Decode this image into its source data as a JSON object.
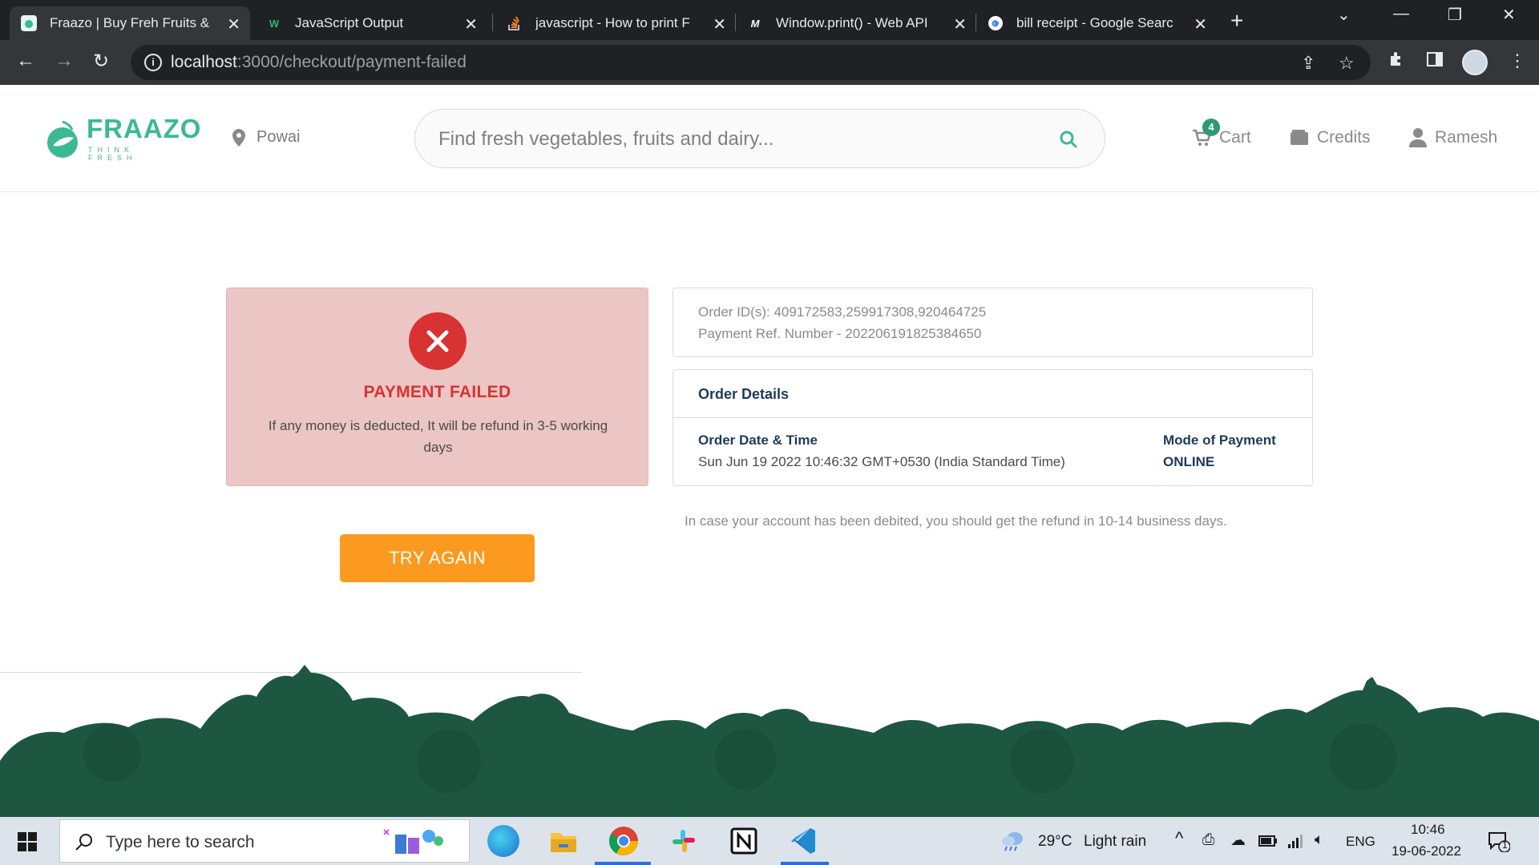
{
  "browser": {
    "tabs": [
      {
        "title": "Fraazo | Buy Freh Fruits &",
        "active": true
      },
      {
        "title": "JavaScript Output",
        "active": false
      },
      {
        "title": "javascript - How to print F",
        "active": false
      },
      {
        "title": "Window.print() - Web API",
        "active": false
      },
      {
        "title": "bill receipt - Google Searc",
        "active": false
      }
    ],
    "url_host": "localhost",
    "url_path": ":3000/checkout/payment-failed"
  },
  "header": {
    "logo_text": "FRAAZO",
    "logo_tagline": "THINK FRESH",
    "location": "Powai",
    "search_placeholder": "Find fresh vegetables, fruits and dairy...",
    "cart_label": "Cart",
    "cart_count": "4",
    "credits_label": "Credits",
    "user_label": "Ramesh"
  },
  "payment": {
    "status_title": "PAYMENT FAILED",
    "status_message": "If any money is deducted, It will be refund in 3-5 working days",
    "try_again_label": "TRY AGAIN",
    "order_ids": "Order ID(s): 409172583,259917308,920464725",
    "payment_ref": "Payment Ref. Number - 202206191825384650",
    "details_title": "Order Details",
    "date_label": "Order Date & Time",
    "date_value": "Sun Jun 19 2022 10:46:32 GMT+0530 (India Standard Time)",
    "mode_label": "Mode of Payment",
    "mode_value": "ONLINE",
    "refund_note": "In case your account has been debited, you should get the refund in 10-14 business days."
  },
  "taskbar": {
    "search_placeholder": "Type here to search",
    "weather_temp": "29°C",
    "weather_desc": "Light rain",
    "language": "ENG",
    "time": "10:46",
    "date": "19-06-2022",
    "notification_count": "1"
  },
  "colors": {
    "brand_green": "#3cb894",
    "fail_red": "#d93232",
    "fail_bg": "#ebc6c4",
    "button_orange": "#fb9a1e",
    "footer_green": "#1d5741"
  }
}
